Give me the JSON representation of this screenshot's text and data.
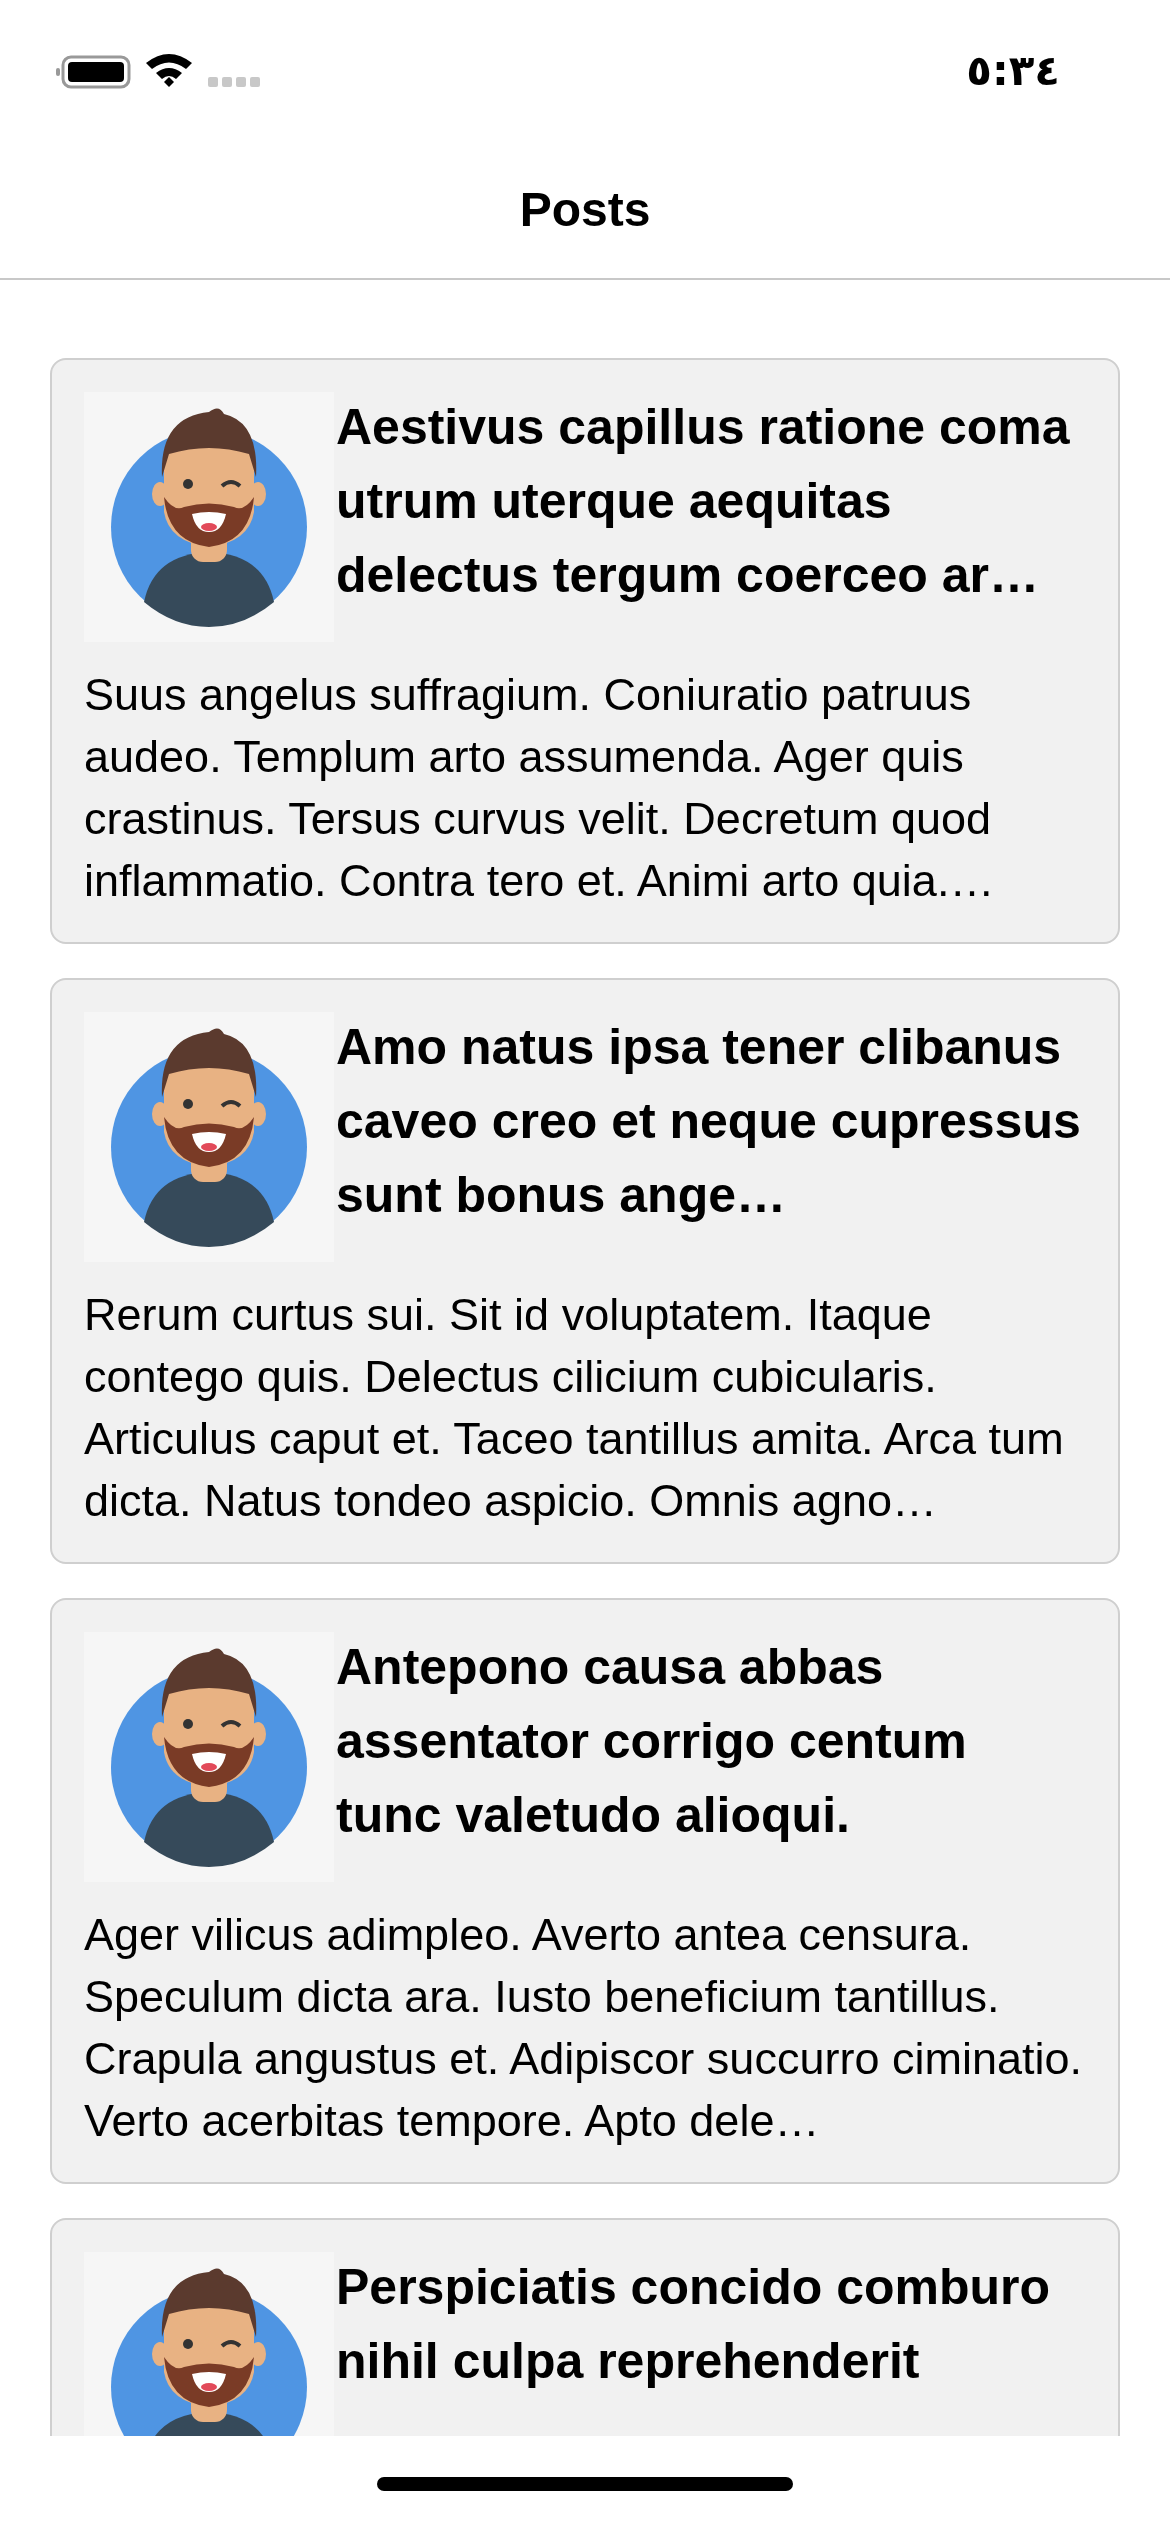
{
  "status_bar": {
    "time": "٥:٣٤"
  },
  "nav": {
    "title": "Posts"
  },
  "posts": [
    {
      "title": "Aestivus capillus ratione coma utrum uterque aequitas delectus tergum coerceo ar…",
      "body": "Suus angelus suffragium. Coniuratio patruus audeo. Templum arto assumenda. Ager quis crastinus. Tersus curvus velit. Decretum quod inflammatio. Contra tero et. Animi arto quia.…"
    },
    {
      "title": "Amo natus ipsa tener clibanus caveo creo et neque cupressus sunt bonus ange…",
      "body": "Rerum curtus sui. Sit id voluptatem. Itaque contego quis. Delectus cilicium cubicularis. Articulus caput et. Taceo tantillus amita. Arca tum dicta. Natus tondeo aspicio. Omnis agno…"
    },
    {
      "title": "Antepono causa abbas assentator corrigo centum tunc valetudo alioqui.",
      "body": "Ager vilicus adimpleo. Averto antea censura. Speculum dicta ara. Iusto beneficium tantillus. Crapula angustus et. Adipiscor succurro ciminatio. Verto acerbitas tempore. Apto dele…"
    },
    {
      "title": "Perspiciatis concido comburo nihil culpa reprehenderit"
    }
  ]
}
